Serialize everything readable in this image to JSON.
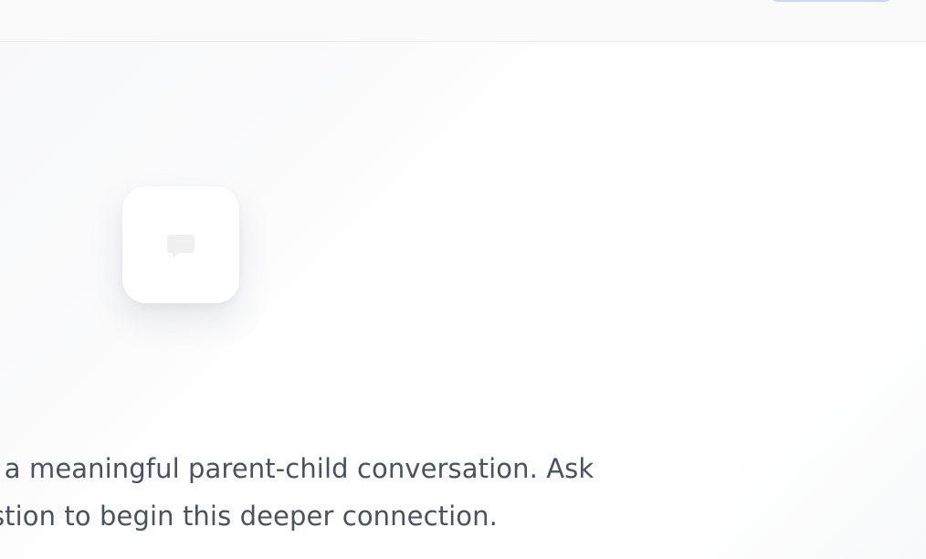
{
  "toolbar": {
    "button_label": ""
  },
  "empty_state": {
    "icon": "chat-icon",
    "line_1": "rt a meaningful parent-child conversation. Ask",
    "line_2": "estion to begin this deeper connection."
  },
  "colors": {
    "text": "#4a5163",
    "border": "#ebecef",
    "button_border": "#c9d7f8"
  }
}
